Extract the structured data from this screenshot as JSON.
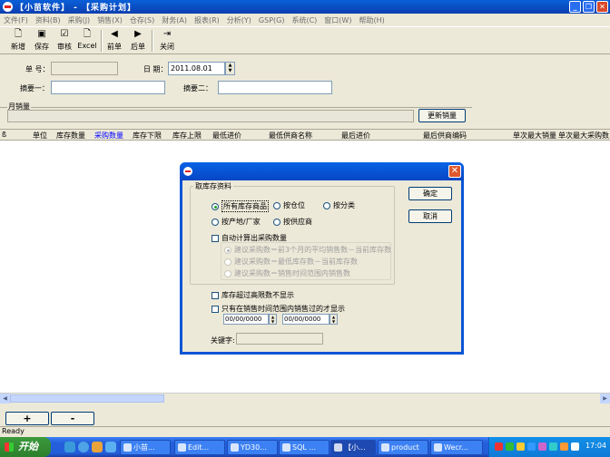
{
  "window": {
    "title": "【小苗软件】 - 【采购计划】"
  },
  "menu": [
    "文件(F)",
    "资料(B)",
    "采购(J)",
    "销售(X)",
    "仓存(S)",
    "财务(A)",
    "报表(R)",
    "分析(Y)",
    "GSP(G)",
    "系统(C)",
    "窗口(W)",
    "帮助(H)"
  ],
  "toolbar": {
    "new": "新增",
    "save": "保存",
    "audit": "审核",
    "excel": "Excel",
    "prev": "前单",
    "next": "后单",
    "close": "关闭"
  },
  "form": {
    "order_no_label": "单 号：",
    "date_label": "日 期：",
    "date_value": "2011.08.01",
    "memo1_label": "摘要一：",
    "memo2_label": "摘要二：",
    "monthly_label": "月销量",
    "update_sales_btn": "更新销量"
  },
  "grid": {
    "headers": [
      "单位",
      "库存数量",
      "采购数量",
      "库存下限",
      "库存上限",
      "最低进价",
      "最低供商名称",
      "最后进价",
      "最后供商编码",
      "单次最大销量",
      "单次最大采购数"
    ]
  },
  "bottom": {
    "add": "+",
    "remove": "-"
  },
  "status": "Ready",
  "dialog": {
    "group_title": "取库存资料",
    "opt_all": "所有库存商品",
    "opt_location": "按仓位",
    "opt_category": "按分类",
    "opt_maker": "按产地/厂家",
    "opt_supplier": "按供应商",
    "auto_calc": "自动计算出采购数量",
    "sug1": "建议采购数＝前3个月的平均销售数－当前库存数",
    "sug2": "建议采购数＝最低库存数－当前库存数",
    "sug3": "建议采购数＝销售时间范围内销售数",
    "over_limit": "库存超过高限数不显示",
    "only_sold": "只有在销售时间范围内销售过的才显示",
    "date_from": "00/00/0000",
    "date_to": "00/00/0000",
    "keyword_label": "关键字:",
    "ok": "确定",
    "cancel": "取消"
  },
  "taskbar": {
    "start": "开始",
    "tasks": [
      "小苗...",
      "Edit...",
      "YD30...",
      "SQL ...",
      "【小...",
      "product",
      "Wecr..."
    ],
    "clock": "17:04"
  }
}
